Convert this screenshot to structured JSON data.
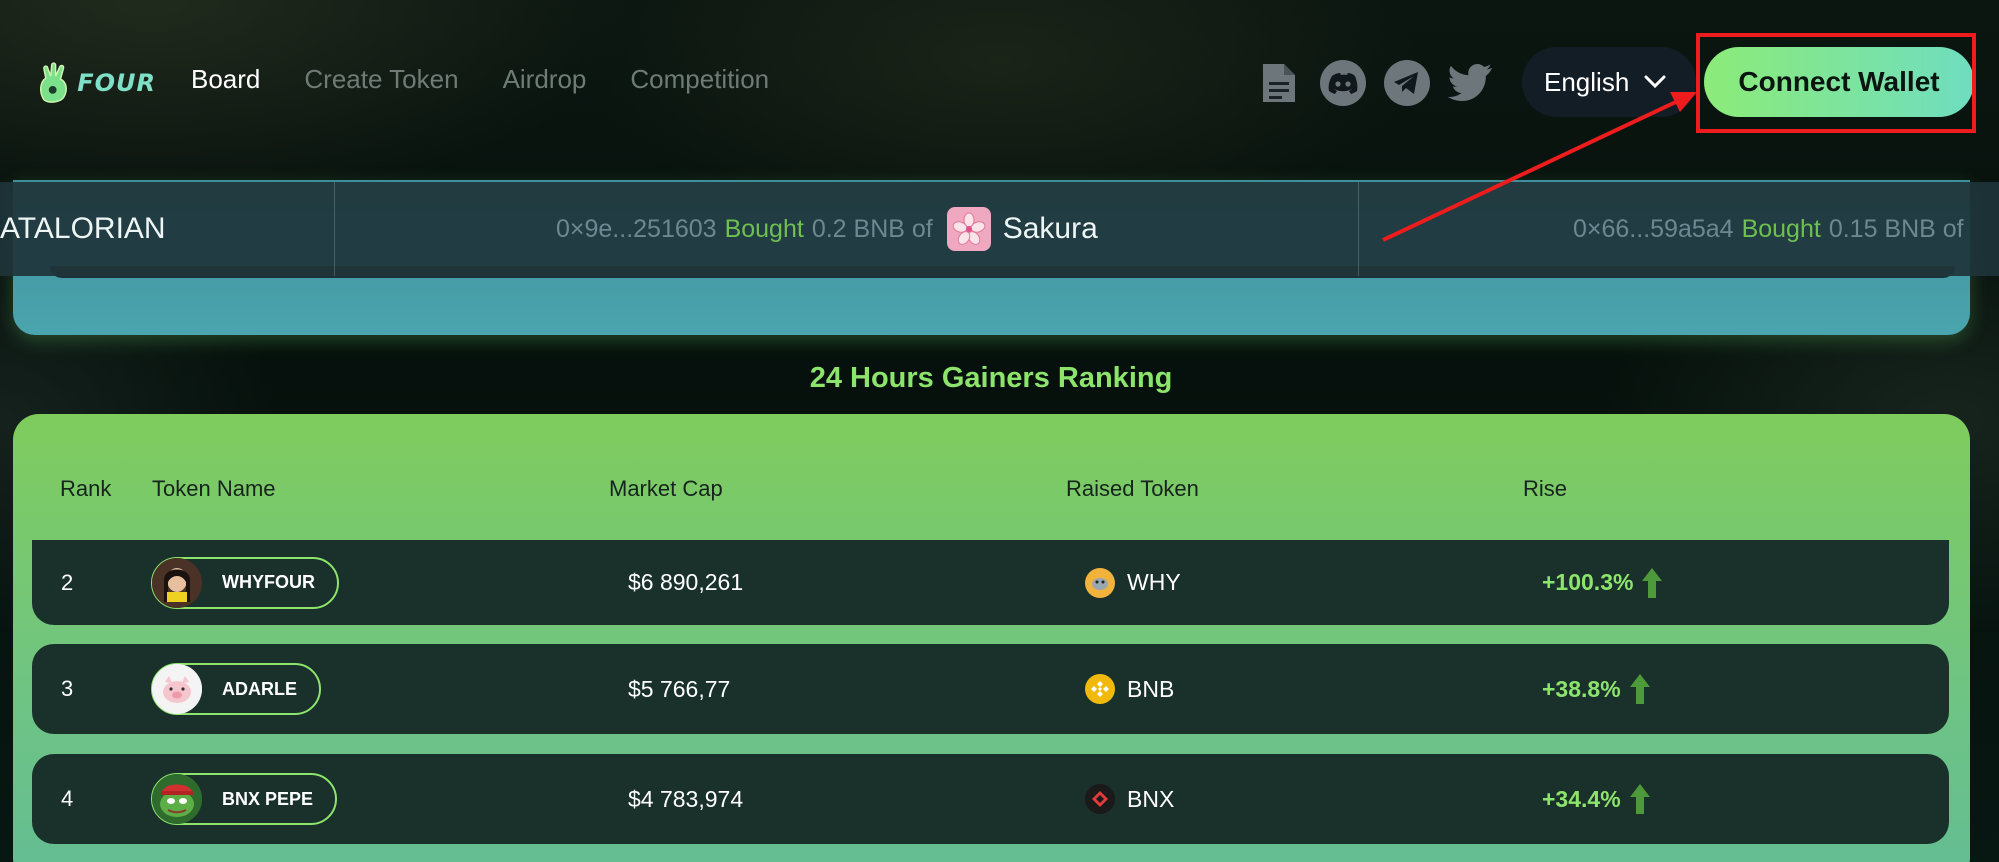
{
  "nav": {
    "brand": "FOUR",
    "items": [
      {
        "label": "Board",
        "active": true
      },
      {
        "label": "Create Token",
        "active": false
      },
      {
        "label": "Airdrop",
        "active": false
      },
      {
        "label": "Competition",
        "active": false
      }
    ]
  },
  "social": [
    "document-icon",
    "discord-icon",
    "telegram-icon",
    "twitter-icon"
  ],
  "language": {
    "selected": "English"
  },
  "wallet": {
    "button_label": "Connect Wallet"
  },
  "ticker": [
    {
      "token": "ATALORIAN"
    },
    {
      "address": "0×9e...251603",
      "action": "Bought",
      "amount": "0.2 BNB of",
      "token": "Sakura"
    },
    {
      "address": "0×66...59a5a4",
      "action": "Bought",
      "amount": "0.15 BNB of"
    }
  ],
  "ranking": {
    "title": "24 Hours Gainers Ranking",
    "headers": {
      "rank": "Rank",
      "token_name": "Token Name",
      "market_cap": "Market Cap",
      "raised_token": "Raised Token",
      "rise": "Rise"
    },
    "rows": [
      {
        "rank": "2",
        "token": "WHYFOUR",
        "market_cap": "$6 890,261",
        "raised": "WHY",
        "rise": "+100.3%"
      },
      {
        "rank": "3",
        "token": "ADARLE",
        "market_cap": "$5 766,77",
        "raised": "BNB",
        "rise": "+38.8%"
      },
      {
        "rank": "4",
        "token": "BNX PEPE",
        "market_cap": "$4 783,974",
        "raised": "BNX",
        "rise": "+34.4%"
      }
    ]
  },
  "colors": {
    "accent_green": "#8de46c",
    "annotation_red": "#ee1c1c",
    "row_bg": "#19302b"
  }
}
